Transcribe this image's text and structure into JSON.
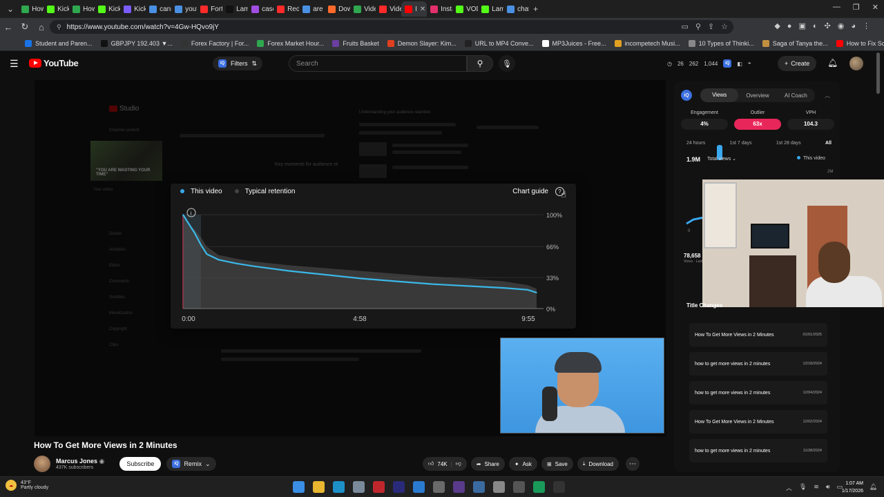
{
  "browser": {
    "tabs": [
      {
        "label": "How",
        "color": "#2fa84f"
      },
      {
        "label": "Kick",
        "color": "#53fc18"
      },
      {
        "label": "How",
        "color": "#2fa84f"
      },
      {
        "label": "Kick",
        "color": "#53fc18"
      },
      {
        "label": "Kick",
        "color": "#7b5cff"
      },
      {
        "label": "cann",
        "color": "#4a90e2"
      },
      {
        "label": "yout",
        "color": "#4a90e2"
      },
      {
        "label": "Fortr",
        "color": "#ff2a2a"
      },
      {
        "label": "Lama",
        "color": "#111111"
      },
      {
        "label": "case",
        "color": "#a04de0"
      },
      {
        "label": "Redg",
        "color": "#ff2a2a"
      },
      {
        "label": "are i",
        "color": "#4a90e2"
      },
      {
        "label": "Dow",
        "color": "#ff6a2a"
      },
      {
        "label": "Vide",
        "color": "#2fa84f"
      },
      {
        "label": "Vide",
        "color": "#ff2a2a"
      },
      {
        "label": "I",
        "color": "#ff0000"
      },
      {
        "label": "Insta",
        "color": "#e1306c"
      },
      {
        "label": "VOD",
        "color": "#53fc18"
      },
      {
        "label": "Lama",
        "color": "#53fc18"
      },
      {
        "label": "chat",
        "color": "#4a90e2"
      }
    ],
    "new_tab": "+",
    "url": "https://www.youtube.com/watch?v=4Gw-HQvo9jY",
    "bookmarks": [
      {
        "label": "Student and Paren...",
        "color": "#1a73e8"
      },
      {
        "label": "GBPJPY 192.403 ▼...",
        "color": "#111111"
      },
      {
        "label": "Forex Factory | For...",
        "color": "#333333"
      },
      {
        "label": "Forex Market Hour...",
        "color": "#2fa84f"
      },
      {
        "label": "Fruits Basket",
        "color": "#6a3fa0"
      },
      {
        "label": "Demon Slayer: Kim...",
        "color": "#e04020"
      },
      {
        "label": "URL to MP4 Conve...",
        "color": "#222222"
      },
      {
        "label": "MP3Juices - Free...",
        "color": "#ffffff"
      },
      {
        "label": "incompetech Musi...",
        "color": "#e0a020"
      },
      {
        "label": "10 Types of Thinki...",
        "color": "#888888"
      },
      {
        "label": "Saga of Tanya the...",
        "color": "#c09040"
      },
      {
        "label": "How to Fix Screen...",
        "color": "#ff0000"
      }
    ]
  },
  "youtube": {
    "brand": "YouTube",
    "filters_label": "Filters",
    "search_placeholder": "Search",
    "stats": [
      "26",
      "262",
      "1,044"
    ],
    "create_label": "Create"
  },
  "studio_ghost": {
    "studio_label": "Studio",
    "channel_content": "Channel content",
    "thumb_text": "\"YOU ARE WASTING YOUR TIME\"",
    "your_video": "Your video",
    "key_moments": "Key moments for audience re",
    "understanding": "Understanding your audience retention",
    "menu": [
      "Details",
      "Analytics",
      "Editor",
      "Comments",
      "Subtitles",
      "Monetization",
      "Copyright",
      "Clips"
    ]
  },
  "retention_card": {
    "legend_this": "This video",
    "legend_typical": "Typical retention",
    "chart_guide": "Chart guide",
    "this_color": "#3aa8ef",
    "typical_color": "#6e6e6e"
  },
  "chart_data": {
    "type": "area",
    "x_ticks": [
      "0:00",
      "4:58",
      "9:55"
    ],
    "y_ticks": [
      "100%",
      "66%",
      "33%",
      "0%"
    ],
    "ylim": [
      0,
      100
    ],
    "xlim": [
      0,
      595
    ],
    "series": [
      {
        "name": "This video",
        "x": [
          0,
          10,
          20,
          30,
          40,
          60,
          90,
          120,
          180,
          240,
          300,
          360,
          420,
          480,
          540,
          580,
          595
        ],
        "values": [
          100,
          90,
          80,
          68,
          58,
          52,
          48,
          45,
          40,
          36,
          32,
          29,
          26,
          24,
          22,
          20,
          17
        ]
      },
      {
        "name": "Typical retention",
        "x": [
          0,
          10,
          20,
          30,
          40,
          60,
          90,
          120,
          180,
          240,
          300,
          360,
          420,
          480,
          540,
          580,
          595
        ],
        "values": [
          100,
          90,
          84,
          76,
          66,
          57,
          53,
          50,
          46,
          43,
          40,
          37,
          34,
          32,
          29,
          25,
          21
        ]
      }
    ]
  },
  "video": {
    "title": "How To Get More Views in 2 Minutes",
    "channel": "Marcus Jones",
    "subs": "437K subscribers",
    "subscribe_label": "Subscribe",
    "remix_label": "Remix",
    "likes": "74K",
    "share_label": "Share",
    "ask_label": "Ask",
    "save_label": "Save",
    "download_label": "Download"
  },
  "iq_panel": {
    "logo": "iQ",
    "tabs": [
      "Views",
      "Overview",
      "AI Coach"
    ],
    "metrics": [
      {
        "label": "Engagement",
        "value": "4%"
      },
      {
        "label": "Outlier",
        "value": "63x"
      },
      {
        "label": "VPH",
        "value": "104.3"
      }
    ],
    "ranges": [
      "24 hours",
      "1st 7 days",
      "1st 28 days",
      "All"
    ],
    "total_value": "1.9M",
    "total_label": "Total views",
    "legend": "This video",
    "axis_top": "2M",
    "axis_bottom": "0",
    "big_number": "78,658",
    "big_sub": "Views · Last",
    "title_changes_label": "Title Changes",
    "title_changes": [
      {
        "title": "How To Get More Views in 2 Minutes",
        "date": "01/01/2025"
      },
      {
        "title": "how to get more views in 2 minutes",
        "date": "12/18/2024"
      },
      {
        "title": "how to get more views in 2 minutes",
        "date": "12/04/2024"
      },
      {
        "title": "How To Get More Views in 2 Minutes",
        "date": "12/02/2024"
      },
      {
        "title": "how to get more views in 2 minutes",
        "date": "11/28/2024"
      }
    ]
  },
  "taskbar": {
    "temp": "43°F",
    "weather": "Partly cloudy",
    "time": "1:07 AM",
    "date": "1/17/2026"
  }
}
